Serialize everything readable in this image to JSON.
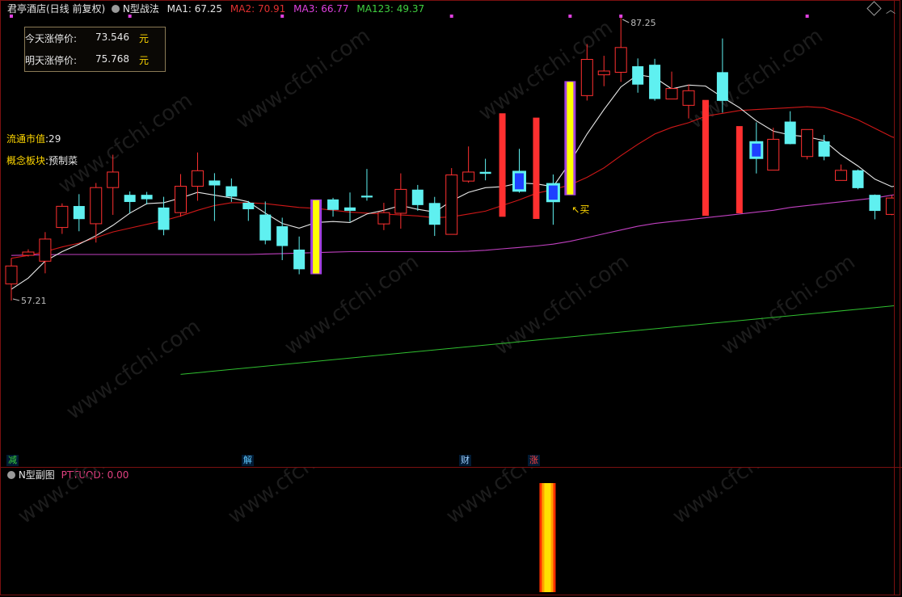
{
  "header": {
    "stock_title": "君亭酒店(日线 前复权)",
    "indicator_name": "N型战法",
    "ma1": "MA1: 67.25",
    "ma2": "MA2: 70.91",
    "ma3": "MA3: 66.77",
    "ma123": "MA123: 49.37"
  },
  "limit_box": {
    "today_label": "今天涨停价:",
    "today_value": "73.546",
    "today_unit": "元",
    "tomorrow_label": "明天涨停价:",
    "tomorrow_value": "75.768",
    "tomorrow_unit": "元"
  },
  "info": {
    "float_cap_label": "流通市值",
    "float_cap_value": ":29",
    "concept_label": "概念板块",
    "concept_value": ":预制菜"
  },
  "annotations": {
    "high_label": "87.25",
    "low_label": "57.21",
    "buy_label": "买"
  },
  "signals": [
    {
      "text": "减",
      "color": "#3cd23c"
    },
    {
      "text": "解",
      "color": "#5fc8ff"
    },
    {
      "text": "财",
      "color": "#9fd0ff"
    },
    {
      "text": "涨",
      "color": "#ff4040"
    }
  ],
  "sub_panel": {
    "name": "N型副图",
    "value_label": "PTTUQD: 0.00"
  },
  "watermark": "www.cfchi.com",
  "colors": {
    "up": "#ff3030",
    "down": "#5ff0f0",
    "ma1": "#e8e8e8",
    "ma2": "#d01818",
    "ma3": "#c040c0",
    "ma123": "#30c030",
    "yellow_bar": "#ffff00",
    "purple_edge": "#a040e0",
    "blue_bar": "#1e40ff"
  },
  "chart_data": {
    "type": "candlestick",
    "y_high": 87.25,
    "y_low": 57.21,
    "candles": [
      {
        "o": 58.98,
        "c": 60.88,
        "h": 61.7,
        "l": 57.21
      },
      {
        "o": 62.01,
        "c": 62.36,
        "h": 62.65,
        "l": 61.88
      },
      {
        "o": 61.39,
        "c": 63.74,
        "h": 64.48,
        "l": 60.1
      },
      {
        "o": 64.97,
        "c": 67.22,
        "h": 67.53,
        "l": 64.29
      },
      {
        "o": 67.25,
        "c": 65.86,
        "h": 68.51,
        "l": 64.57
      },
      {
        "o": 65.37,
        "c": 69.21,
        "h": 69.7,
        "l": 63.37
      },
      {
        "o": 69.21,
        "c": 70.86,
        "h": 72.7,
        "l": 66.31
      },
      {
        "o": 68.44,
        "c": 67.68,
        "h": 68.8,
        "l": 66.49
      },
      {
        "o": 68.44,
        "c": 67.97,
        "h": 68.75,
        "l": 67.41
      },
      {
        "o": 67.09,
        "c": 64.72,
        "h": 68.23,
        "l": 64.14
      },
      {
        "o": 66.55,
        "c": 69.35,
        "h": 70.64,
        "l": 66.12
      },
      {
        "o": 69.35,
        "c": 71.0,
        "h": 72.94,
        "l": 67.81
      },
      {
        "o": 69.96,
        "c": 69.44,
        "h": 70.74,
        "l": 65.66
      },
      {
        "o": 69.35,
        "c": 68.25,
        "h": 70.18,
        "l": 67.69
      },
      {
        "o": 67.6,
        "c": 66.91,
        "h": 67.79,
        "l": 65.67
      },
      {
        "o": 66.34,
        "c": 63.59,
        "h": 67.73,
        "l": 63.18
      },
      {
        "o": 65.1,
        "c": 63.0,
        "h": 66.01,
        "l": 61.5
      },
      {
        "o": 62.62,
        "c": 60.53,
        "h": 64.01,
        "l": 60.0
      },
      {
        "o": 60.0,
        "c": 67.95,
        "h": 67.95,
        "l": 60.0,
        "style": "yellow"
      },
      {
        "o": 67.95,
        "c": 66.84,
        "h": 68.12,
        "l": 66.12
      },
      {
        "o": 67.1,
        "c": 66.74,
        "h": 68.69,
        "l": 65.59
      },
      {
        "o": 68.35,
        "c": 68.16,
        "h": 71.19,
        "l": 67.82
      },
      {
        "o": 65.35,
        "c": 66.55,
        "h": 67.59,
        "l": 64.69
      },
      {
        "o": 66.48,
        "c": 69.02,
        "h": 70.72,
        "l": 64.84
      },
      {
        "o": 68.99,
        "c": 67.35,
        "h": 69.49,
        "l": 66.75
      },
      {
        "o": 67.57,
        "c": 65.26,
        "h": 68.22,
        "l": 64.07
      },
      {
        "o": 64.24,
        "c": 70.55,
        "h": 71.28,
        "l": 64.24
      },
      {
        "o": 69.9,
        "c": 70.86,
        "h": 73.58,
        "l": 69.72
      },
      {
        "o": 70.88,
        "c": 70.67,
        "h": 72.27,
        "l": 69.98
      },
      {
        "o": 66.11,
        "c": 77.1,
        "h": 77.1,
        "l": 66.11,
        "style": "red_tall"
      },
      {
        "o": 70.86,
        "c": 68.9,
        "h": 73.32,
        "l": 68.67,
        "style": "blue"
      },
      {
        "o": 65.88,
        "c": 76.64,
        "h": 76.64,
        "l": 65.88,
        "style": "red_tall"
      },
      {
        "o": 69.56,
        "c": 67.79,
        "h": 70.6,
        "l": 65.26,
        "style": "blue"
      },
      {
        "o": 68.39,
        "c": 80.52,
        "h": 81.15,
        "l": 68.39,
        "style": "yellow"
      },
      {
        "o": 78.98,
        "c": 82.83,
        "h": 84.46,
        "l": 78.46
      },
      {
        "o": 81.19,
        "c": 81.59,
        "h": 83.21,
        "l": 79.98
      },
      {
        "o": 81.46,
        "c": 84.09,
        "h": 87.25,
        "l": 80.44
      },
      {
        "o": 82.1,
        "c": 80.15,
        "h": 82.93,
        "l": 79.29
      },
      {
        "o": 82.26,
        "c": 78.62,
        "h": 82.89,
        "l": 78.44
      },
      {
        "o": 78.62,
        "c": 79.73,
        "h": 81.53,
        "l": 78.59
      },
      {
        "o": 77.95,
        "c": 79.5,
        "h": 80.17,
        "l": 76.55
      },
      {
        "o": 66.21,
        "c": 78.52,
        "h": 78.52,
        "l": 66.21,
        "style": "red_tall"
      },
      {
        "o": 81.47,
        "c": 78.42,
        "h": 85.05,
        "l": 77.17
      },
      {
        "o": 66.48,
        "c": 75.74,
        "h": 75.74,
        "l": 66.48,
        "style": "red_tall"
      },
      {
        "o": 74.01,
        "c": 72.38,
        "h": 76.14,
        "l": 70.71,
        "style": "blue"
      },
      {
        "o": 71.06,
        "c": 74.34,
        "h": 75.56,
        "l": 71.06
      },
      {
        "o": 76.22,
        "c": 73.83,
        "h": 77.32,
        "l": 73.81
      },
      {
        "o": 72.51,
        "c": 75.38,
        "h": 75.38,
        "l": 72.2
      },
      {
        "o": 74.12,
        "c": 72.5,
        "h": 74.8,
        "l": 72.11
      },
      {
        "o": 69.97,
        "c": 71.04,
        "h": 71.66,
        "l": 69.97
      },
      {
        "o": 71.05,
        "c": 69.15,
        "h": 71.14,
        "l": 69.03
      },
      {
        "o": 68.44,
        "c": 66.73,
        "h": 68.48,
        "l": 65.84
      },
      {
        "o": 66.36,
        "c": 68.1,
        "h": 68.4,
        "l": 66.28
      },
      {
        "o": 67.98,
        "c": 70.73,
        "h": 71.31,
        "l": 67.95
      }
    ],
    "ma1": [
      58.4,
      59.6,
      61.4,
      62.4,
      63.2,
      64.1,
      65.2,
      66.5,
      67.5,
      67.6,
      68.1,
      68.7,
      68.4,
      68.1,
      67.7,
      66.5,
      65.4,
      64.9,
      65.5,
      65.6,
      65.5,
      66.4,
      66.8,
      67.3,
      66.9,
      66.6,
      67.8,
      68.7,
      69.2,
      69.3,
      69.7,
      69.6,
      69.3,
      71.9,
      74.9,
      77.5,
      79.9,
      81.2,
      80.9,
      79.7,
      80.1,
      80.0,
      78.8,
      77.7,
      76.3,
      75.2,
      74.8,
      74.6,
      74.2,
      72.7,
      71.5,
      70.1,
      69.3,
      69.7
    ],
    "ma2": [
      61.7,
      62.0,
      62.4,
      62.9,
      63.3,
      63.9,
      64.5,
      64.9,
      65.3,
      65.7,
      66.2,
      66.8,
      67.3,
      67.6,
      67.6,
      67.5,
      67.3,
      67.1,
      67.0,
      66.8,
      66.6,
      66.5,
      66.4,
      66.3,
      66.2,
      66.0,
      66.1,
      66.4,
      66.7,
      67.3,
      67.9,
      68.6,
      69.0,
      69.5,
      70.3,
      71.3,
      72.6,
      73.8,
      74.9,
      75.6,
      76.1,
      76.8,
      77.1,
      77.4,
      77.5,
      77.6,
      77.7,
      77.8,
      77.7,
      77.1,
      76.4,
      75.5,
      74.6,
      74.1
    ],
    "ma3": [
      62.0,
      62.04,
      62.08,
      62.1,
      62.1,
      62.1,
      62.1,
      62.1,
      62.1,
      62.1,
      62.1,
      62.1,
      62.1,
      62.1,
      62.1,
      62.15,
      62.2,
      62.25,
      62.3,
      62.35,
      62.4,
      62.4,
      62.4,
      62.4,
      62.4,
      62.4,
      62.4,
      62.45,
      62.55,
      62.7,
      62.85,
      63.0,
      63.2,
      63.5,
      63.9,
      64.3,
      64.7,
      65.1,
      65.4,
      65.6,
      65.8,
      66.0,
      66.2,
      66.4,
      66.6,
      66.8,
      67.1,
      67.3,
      67.5,
      67.7,
      67.9,
      68.1,
      68.4,
      68.7
    ],
    "ma123_line": {
      "y_start": 49.37,
      "y_end": 56.8,
      "start_index": 10,
      "end_index": 53
    }
  }
}
